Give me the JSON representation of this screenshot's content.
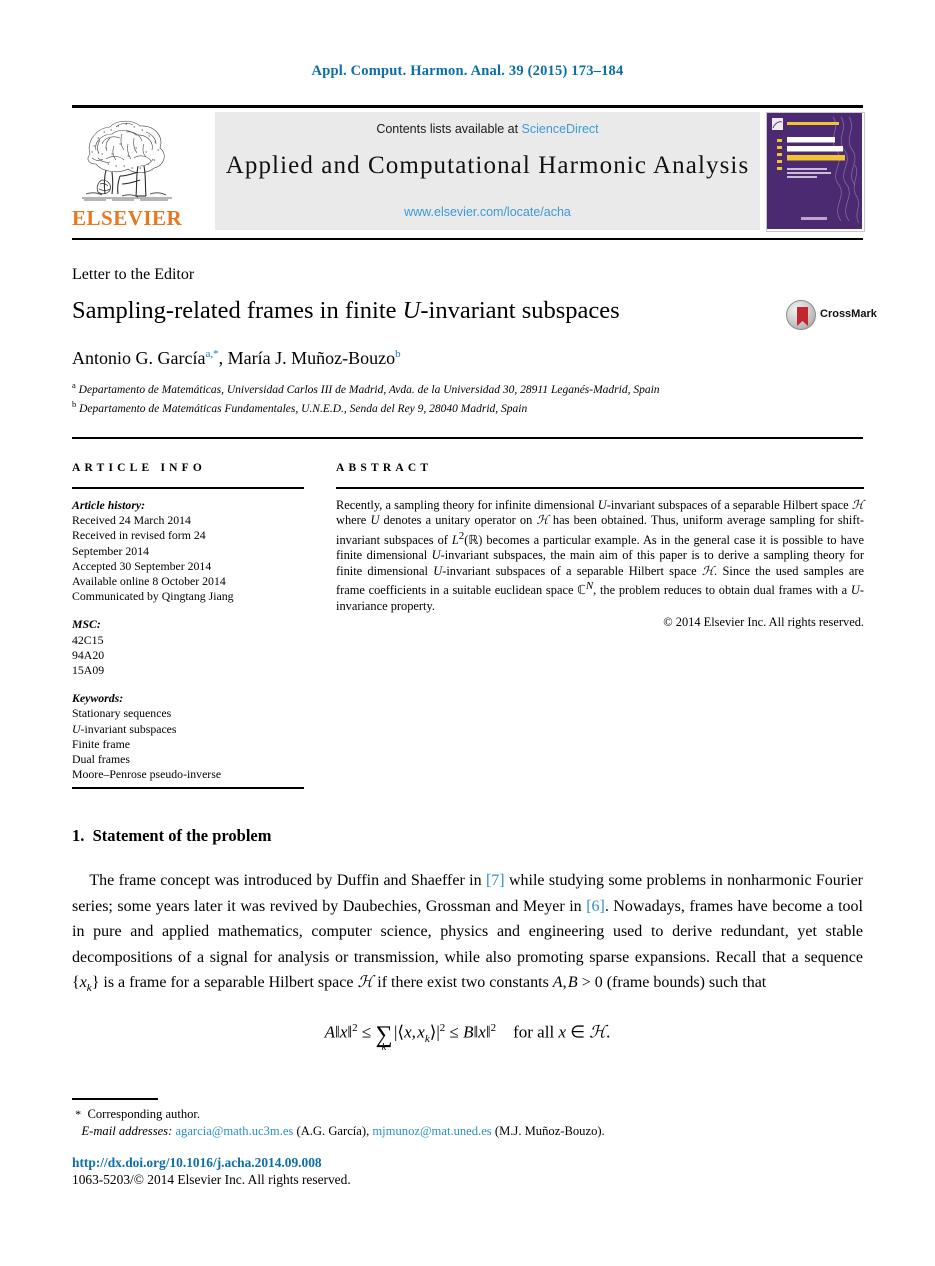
{
  "running_head": "Appl. Comput. Harmon. Anal. 39 (2015) 173–184",
  "masthead": {
    "publisher_name": "ELSEVIER",
    "contents_prefix": "Contents lists available at ",
    "sciencedirect": "ScienceDirect",
    "journal_title": "Applied and Computational Harmonic Analysis",
    "journal_url": "www.elsevier.com/locate/acha",
    "cover": {
      "line1": "Applied and",
      "line2": "Computational",
      "line3": "Harmonic Analysis",
      "background": "#4b2a72"
    }
  },
  "article": {
    "kicker": "Letter to the Editor",
    "title": "Sampling-related frames in finite U-invariant subspaces",
    "title_italic_part": "U",
    "crossmark_label": "CrossMark",
    "authors_1": "Antonio G. García",
    "authors_1_marks": "a,*",
    "authors_sep": ", ",
    "authors_2": "María J. Muñoz-Bouzo",
    "authors_2_marks": "b",
    "affiliation_a_mark": "a",
    "affiliation_a": "Departamento de Matemáticas, Universidad Carlos III de Madrid, Avda. de la Universidad 30, 28911 Leganés-Madrid, Spain",
    "affiliation_b_mark": "b",
    "affiliation_b": "Departamento de Matemáticas Fundamentales, U.N.E.D., Senda del Rey 9, 28040 Madrid, Spain"
  },
  "info": {
    "heading": "ARTICLE INFO",
    "history_label": "Article history:",
    "history": [
      "Received 24 March 2014",
      "Received in revised form 24",
      "September 2014",
      "Accepted 30 September 2014",
      "Available online 8 October 2014",
      "Communicated by Qingtang Jiang"
    ],
    "msc_label": "MSC:",
    "msc": [
      "42C15",
      "94A20",
      "15A09"
    ],
    "keywords_label": "Keywords:",
    "keywords": [
      "Stationary sequences",
      "U-invariant subspaces",
      "Finite frame",
      "Dual frames",
      "Moore–Penrose pseudo-inverse"
    ]
  },
  "abstract": {
    "heading": "ABSTRACT",
    "text": "Recently, a sampling theory for infinite dimensional U-invariant subspaces of a separable Hilbert space H where U denotes a unitary operator on H has been obtained. Thus, uniform average sampling for shift-invariant subspaces of L2(R) becomes a particular example. As in the general case it is possible to have finite dimensional U-invariant subspaces, the main aim of this paper is to derive a sampling theory for finite dimensional U-invariant subspaces of a separable Hilbert space H. Since the used samples are frame coefficients in a suitable euclidean space CN, the problem reduces to obtain dual frames with a U-invariance property.",
    "copyright": "© 2014 Elsevier Inc. All rights reserved."
  },
  "body": {
    "section_number": "1.",
    "section_title": "Statement of the problem",
    "paragraph_part1": "The frame concept was introduced by Duffin and Shaeffer in ",
    "ref1": "[7]",
    "paragraph_part2": " while studying some problems in nonharmonic Fourier series; some years later it was revived by Daubechies, Grossman and Meyer in ",
    "ref2": "[6]",
    "paragraph_part3": ". Nowadays, frames have become a tool in pure and applied mathematics, computer science, physics and engineering used to derive redundant, yet stable decompositions of a signal for analysis or transmission, while also promoting sparse expansions. Recall that a sequence {xk} is a frame for a separable Hilbert space H if there exist two constants A, B > 0 (frame bounds) such that",
    "equation": "A‖x‖² ≤ Σk |⟨x, xk⟩|² ≤ B‖x‖²   for all x ∈ H."
  },
  "footer": {
    "corresponding_mark": "*",
    "corresponding_text": "Corresponding author.",
    "email_label": "E-mail addresses:",
    "email_1": "agarcia@math.uc3m.es",
    "email_1_owner": "(A.G. García),",
    "email_2": "mjmunoz@mat.uned.es",
    "email_2_owner": "(M.J. Muñoz-Bouzo).",
    "doi": "http://dx.doi.org/10.1016/j.acha.2014.09.008",
    "issn_copyright": "1063-5203/© 2014 Elsevier Inc. All rights reserved."
  },
  "colors": {
    "link_blue": "#2b8fc9",
    "head_blue": "#0b6ea8",
    "elsevier_orange": "#e87722",
    "cover_purple": "#4b2a72",
    "crossmark_red": "#c1272d",
    "contents_gray": "#eaeaea"
  }
}
